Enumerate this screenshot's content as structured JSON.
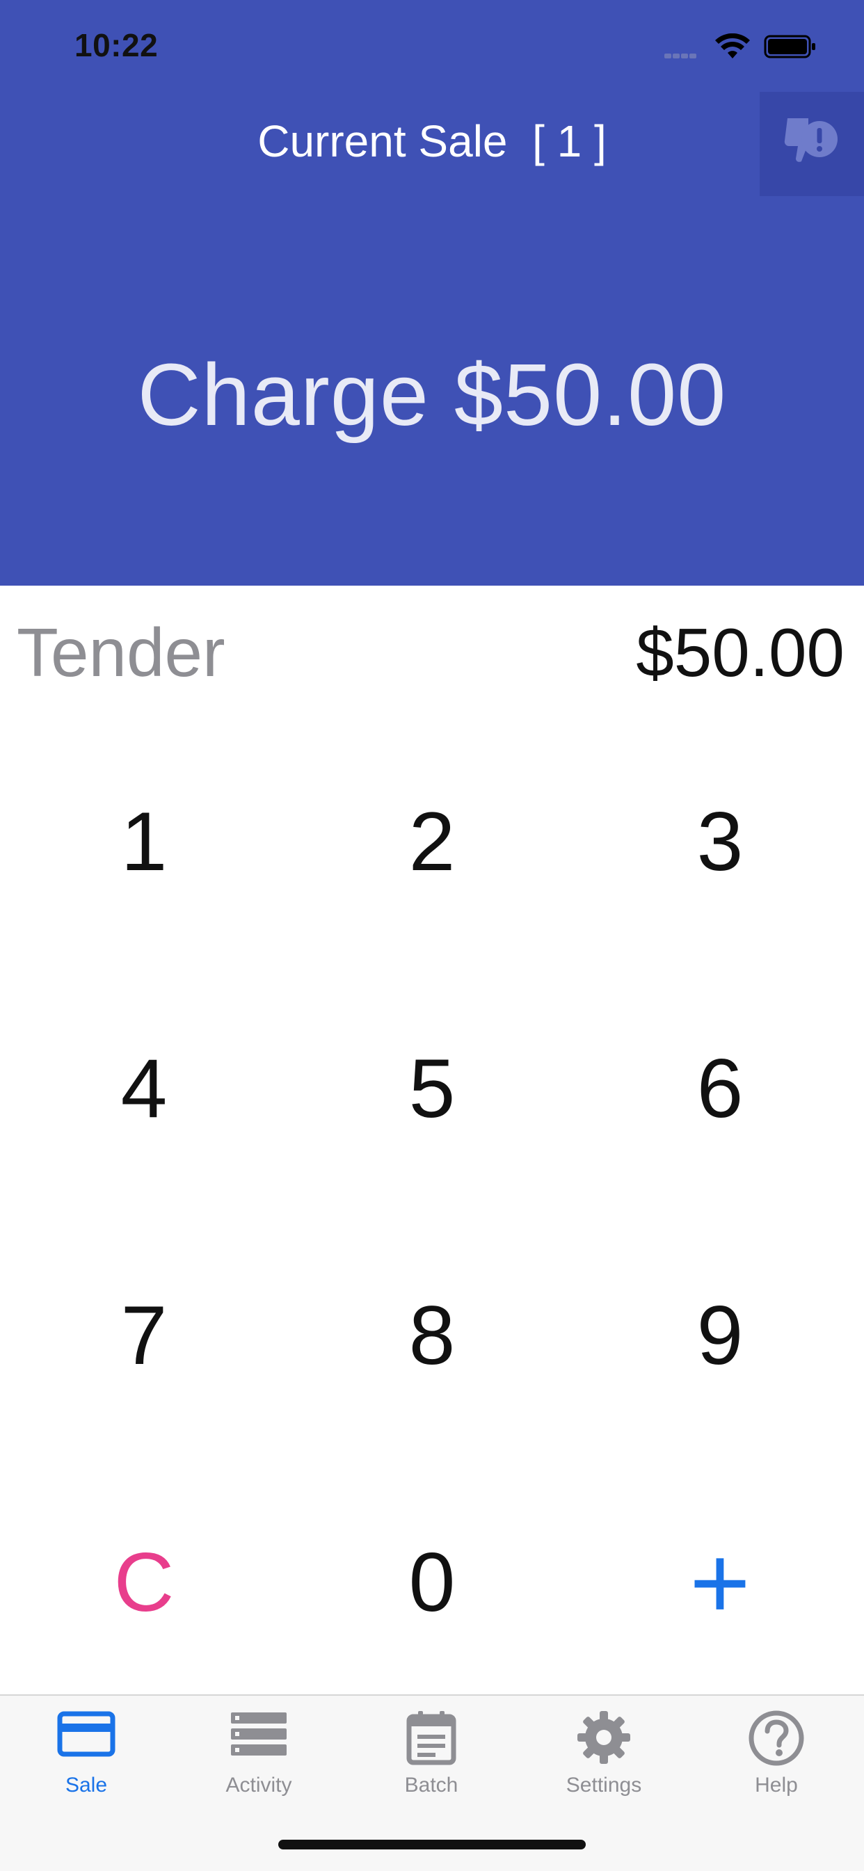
{
  "status_bar": {
    "time": "10:22"
  },
  "header": {
    "title": "Current Sale  [ 1 ]",
    "charge_label": "Charge $50.00",
    "alert_icon": "thumbs-down-alert-icon"
  },
  "tender": {
    "label": "Tender",
    "amount": "$50.00"
  },
  "keypad": {
    "keys": [
      "1",
      "2",
      "3",
      "4",
      "5",
      "6",
      "7",
      "8",
      "9",
      "C",
      "0",
      "+"
    ]
  },
  "tabs": [
    {
      "label": "Sale",
      "icon": "credit-card-icon",
      "active": true
    },
    {
      "label": "Activity",
      "icon": "list-icon",
      "active": false
    },
    {
      "label": "Batch",
      "icon": "calendar-icon",
      "active": false
    },
    {
      "label": "Settings",
      "icon": "gear-icon",
      "active": false
    },
    {
      "label": "Help",
      "icon": "help-icon",
      "active": false
    }
  ],
  "colors": {
    "header_background": "#3f51b5",
    "accent": "#1a73e8",
    "clear_key": "#e83e8c",
    "muted_text": "#8e8e93"
  }
}
